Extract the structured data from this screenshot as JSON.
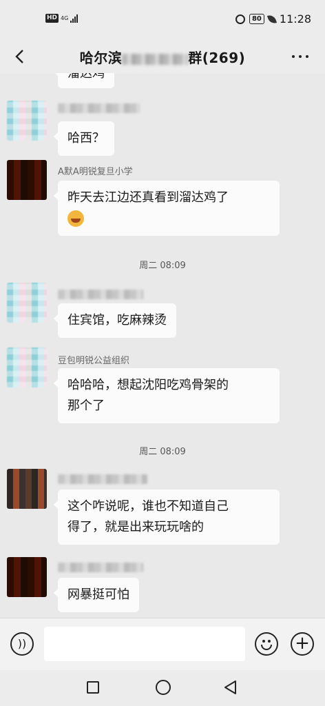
{
  "status_bar": {
    "hd": "HD",
    "network": "4G",
    "battery": "80",
    "time": "11:28"
  },
  "header": {
    "title_prefix": "哈尔滨",
    "title_suffix": "群(269)"
  },
  "messages": [
    {
      "sender": "",
      "text": "溜达鸡"
    },
    {
      "sender": "",
      "text": "哈西？"
    },
    {
      "sender": "A默A明锐复旦小学",
      "text": "昨天去江边还真看到溜达鸡了"
    },
    {
      "sender": "",
      "text": "住宾馆，吃麻辣烫"
    },
    {
      "sender": "豆包明锐公益组织",
      "text_line1": "哈哈哈，想起沈阳吃鸡骨架的",
      "text_line2": "那个了"
    },
    {
      "sender": "",
      "text_line1": "这个咋说呢，谁也不知道自己",
      "text_line2": "得了，就是出来玩玩啥的"
    },
    {
      "sender": "",
      "text": "网暴挺可怕"
    }
  ],
  "timestamps": [
    "周二 08:09",
    "周二 08:09"
  ],
  "colors": {
    "background": "#e9e9e9",
    "bubble": "#fbfbfb",
    "name_text": "#666666"
  },
  "icons": [
    "back-arrow-icon",
    "more-icon",
    "voice-icon",
    "emoji-icon",
    "plus-icon",
    "nav-home-icon",
    "nav-recents-icon",
    "nav-back-icon"
  ]
}
